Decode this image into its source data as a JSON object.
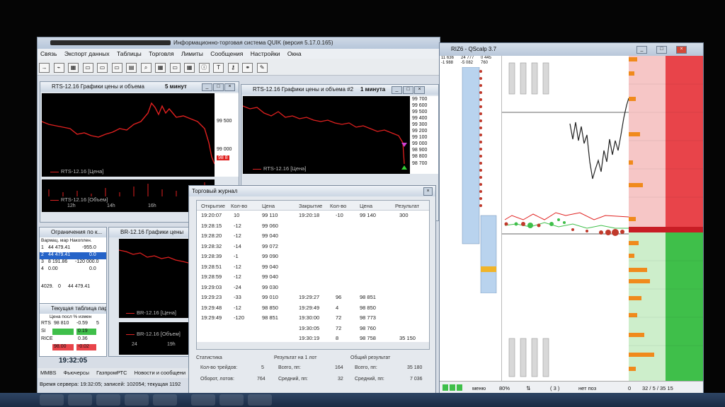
{
  "quik": {
    "title": "Информационно-торговая система QUIK (версия 5.17.0.165)",
    "menu": [
      "Связь",
      "Экспорт данных",
      "Таблицы",
      "Торговля",
      "Лимиты",
      "Сообщения",
      "Настройки",
      "Окна"
    ]
  },
  "chart1": {
    "title": "RTS-12.16 Графики цены и объема",
    "interval": "5 минут",
    "price_labels": [
      "99 500",
      "99 000"
    ],
    "current_price": "98 8",
    "price_legend": "RTS-12.16 [Цена]",
    "volume_legend": "RTS-12.16 [Объем]",
    "time_labels": [
      "12h",
      "14h",
      "16h"
    ]
  },
  "chart2": {
    "title": "RTS-12.16 Графики цены и объема #2",
    "interval": "1 минута",
    "price_labels": [
      "99 700",
      "99 600",
      "99 500",
      "99 400",
      "99 300",
      "99 200",
      "99 100",
      "99 000",
      "98 900",
      "98 800",
      "98 700"
    ],
    "price_legend": "RTS-12.16 [Цена]"
  },
  "limits": {
    "title": "Ограничения по к...",
    "header": "Вармац. мар Накоплен.",
    "rows": [
      [
        "1",
        "44 479.41",
        "-955.0"
      ],
      [
        "2",
        "44 479.41",
        "0.0"
      ],
      [
        "3",
        "8 191.86",
        "-120 000.0"
      ],
      [
        "4",
        "0.00",
        "0.0"
      ]
    ],
    "footer": [
      "4029.",
      "0",
      "44 479.41"
    ]
  },
  "chart3": {
    "title": "BR-12.16 Графики цены",
    "price_legend": "BR-12.16 [Цена]",
    "volume_legend": "BR-12.16 [Объем]",
    "time_labels": [
      "24",
      "19h"
    ]
  },
  "current_table": {
    "title": "Текущая таблица пар",
    "header": "Цена посл % измен",
    "rows": [
      [
        "RTS",
        "98 810",
        "-0.59",
        "5"
      ],
      [
        "SI",
        "",
        "0.19",
        ""
      ],
      [
        "RICE",
        "",
        "0.36",
        ""
      ],
      [
        "",
        "98.00",
        "-0.02",
        ""
      ]
    ]
  },
  "clock": "19:32:05",
  "bottom_tabs": [
    "MMBS",
    "Фьючерсы",
    "ГазпромРТС",
    "Новости и сообщени"
  ],
  "server_status": "Время сервера: 19:32:05; записей: 102054; текущая 1192",
  "journal": {
    "title": "Торговый журнал",
    "headers": [
      "Открытие",
      "Кол-во",
      "Цена",
      "Закрытие",
      "Кол-во",
      "Цена",
      "Результат"
    ],
    "rows": [
      [
        "19:20:07",
        "10",
        "99 110",
        "19:20:18",
        "-10",
        "99 140",
        "300"
      ],
      [
        "19:28:15",
        "-12",
        "99 060",
        "",
        "",
        "",
        ""
      ],
      [
        "19:28:20",
        "-12",
        "99 040",
        "",
        "",
        "",
        ""
      ],
      [
        "19:28:32",
        "-14",
        "99 072",
        "",
        "",
        "",
        ""
      ],
      [
        "19:28:39",
        "-1",
        "99 090",
        "",
        "",
        "",
        ""
      ],
      [
        "19:28:51",
        "-12",
        "99 040",
        "",
        "",
        "",
        ""
      ],
      [
        "19:28:59",
        "-12",
        "99 040",
        "",
        "",
        "",
        ""
      ],
      [
        "19:29:03",
        "-24",
        "99 030",
        "",
        "",
        "",
        ""
      ],
      [
        "19:29:23",
        "-33",
        "99 010",
        "19:29:27",
        "96",
        "98 851",
        ""
      ],
      [
        "19:29:48",
        "-12",
        "98 850",
        "19:29:49",
        "4",
        "98 850",
        ""
      ],
      [
        "19:29:49",
        "-120",
        "98 851",
        "19:30:00",
        "72",
        "98 773",
        ""
      ],
      [
        "",
        "",
        "",
        "19:30:05",
        "72",
        "98 760",
        ""
      ],
      [
        "",
        "",
        "",
        "19:30:19",
        "8",
        "98 758",
        "35 150"
      ]
    ],
    "stats": {
      "col1_title": "Статистика",
      "col2_title": "Результат на 1 лот",
      "col3_title": "Общий результат",
      "trades_label": "Кол-во трейдов:",
      "trades_value": "5",
      "turnover_label": "Оборот, лотов:",
      "turnover_value": "764",
      "total1_label": "Всего, пп:",
      "total1_value": "164",
      "avg1_label": "Средний, пп:",
      "avg1_value": "32",
      "total2_label": "Всего, пп:",
      "total2_value": "35 180",
      "avg2_label": "Средний, пп:",
      "avg2_value": "7 036"
    }
  },
  "qscalp": {
    "title": "RIZ6 - QScalp 3.7",
    "top_values": [
      "11 636",
      "24 777",
      "0 445",
      "-1 988",
      "-5 082",
      "760"
    ],
    "status": {
      "menu": "меню",
      "percent": "80%",
      "arrows": "⇅",
      "count": "( 3 )",
      "position": "нет поз",
      "zero": "0",
      "ratio": "32 / 5 / 35 15"
    }
  },
  "colors": {
    "ask": "#e8444a",
    "bid": "#3fbf4a",
    "price_line": "#e0201f",
    "volume": "#f08a1c"
  }
}
